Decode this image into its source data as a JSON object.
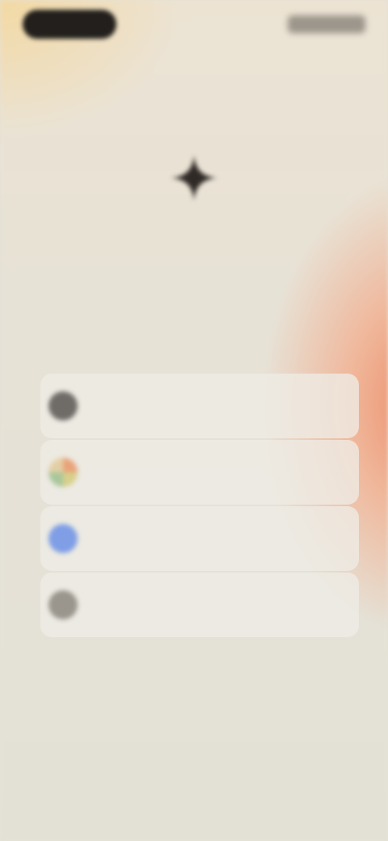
{
  "status_bar": {
    "time": "",
    "icons": [
      "signal-icon",
      "wifi-icon",
      "battery-icon"
    ]
  },
  "app": {
    "logo_icon": "sparkle-icon",
    "brand": "",
    "tagline": ""
  },
  "sign_in_options": [
    {
      "label": "",
      "icon": "apple-icon",
      "color": "#6f6c68"
    },
    {
      "label": "",
      "icon": "google-icon",
      "color": "#d9cfa0"
    },
    {
      "label": "",
      "icon": "facebook-icon",
      "color": "#7f9ee6"
    },
    {
      "label": "",
      "icon": "mail-icon",
      "color": "#9a968e"
    }
  ],
  "legal_text": "",
  "colors": {
    "background": "#e4e1d6",
    "accent_warm": "#ec8d68",
    "accent_yellow": "#f3d9a4",
    "text_dark": "#2a2622"
  }
}
